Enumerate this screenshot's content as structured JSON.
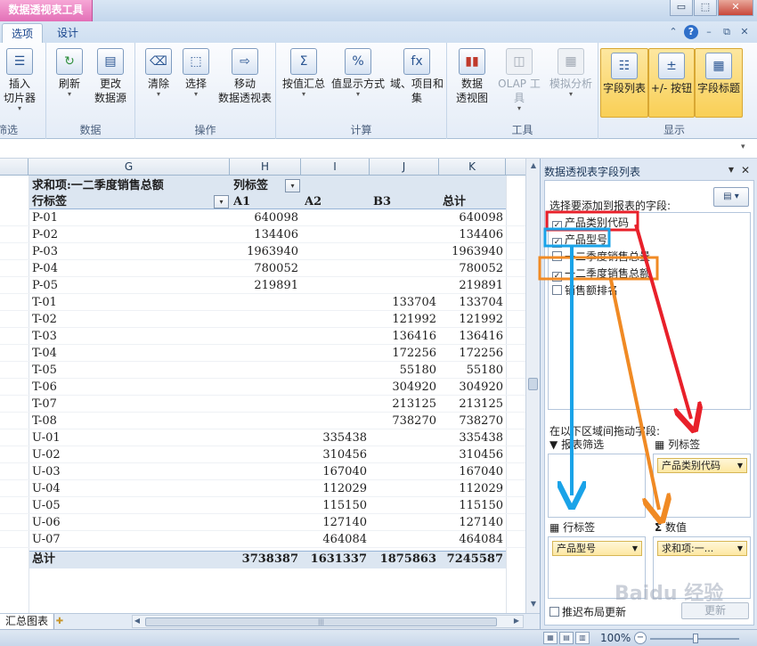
{
  "titlebar": {
    "context_tab": "数据透视表工具",
    "controls": [
      "▭",
      "⬚",
      "✕"
    ]
  },
  "tabs": [
    {
      "label": "选项",
      "active": true
    },
    {
      "label": "设计",
      "active": false
    }
  ],
  "ribbon": {
    "groups": [
      {
        "label": "筛选",
        "buttons": [
          {
            "label": "插入\n切片器"
          }
        ]
      },
      {
        "label": "数据",
        "buttons": [
          {
            "label": "刷新"
          },
          {
            "label": "更改\n数据源"
          }
        ]
      },
      {
        "label": "操作",
        "buttons": [
          {
            "label": "清除"
          },
          {
            "label": "选择"
          },
          {
            "label": "移动\n数据透视表"
          }
        ]
      },
      {
        "label": "计算",
        "buttons": [
          {
            "label": "按值汇总"
          },
          {
            "label": "值显示方式"
          },
          {
            "label": "域、项目和\n集"
          }
        ]
      },
      {
        "label": "工具",
        "buttons": [
          {
            "label": "数据\n透视图"
          },
          {
            "label": "OLAP 工具"
          },
          {
            "label": "模拟分析"
          }
        ]
      },
      {
        "label": "显示",
        "buttons": [
          {
            "label": "字段列表"
          },
          {
            "label": "+/- 按钮"
          },
          {
            "label": "字段标题"
          }
        ]
      }
    ]
  },
  "sheet": {
    "columns": [
      "G",
      "H",
      "I",
      "J",
      "K"
    ],
    "pivot": {
      "value_title": "求和项:一二季度销售总额",
      "col_label_header": "列标签",
      "row_label_header": "行标签",
      "col_items": [
        "A1",
        "A2",
        "B3",
        "总计"
      ],
      "rows": [
        {
          "label": "P-01",
          "a1": "640098",
          "a2": "",
          "b3": "",
          "total": "640098"
        },
        {
          "label": "P-02",
          "a1": "134406",
          "a2": "",
          "b3": "",
          "total": "134406"
        },
        {
          "label": "P-03",
          "a1": "1963940",
          "a2": "",
          "b3": "",
          "total": "1963940"
        },
        {
          "label": "P-04",
          "a1": "780052",
          "a2": "",
          "b3": "",
          "total": "780052"
        },
        {
          "label": "P-05",
          "a1": "219891",
          "a2": "",
          "b3": "",
          "total": "219891"
        },
        {
          "label": "T-01",
          "a1": "",
          "a2": "",
          "b3": "133704",
          "total": "133704"
        },
        {
          "label": "T-02",
          "a1": "",
          "a2": "",
          "b3": "121992",
          "total": "121992"
        },
        {
          "label": "T-03",
          "a1": "",
          "a2": "",
          "b3": "136416",
          "total": "136416"
        },
        {
          "label": "T-04",
          "a1": "",
          "a2": "",
          "b3": "172256",
          "total": "172256"
        },
        {
          "label": "T-05",
          "a1": "",
          "a2": "",
          "b3": "55180",
          "total": "55180"
        },
        {
          "label": "T-06",
          "a1": "",
          "a2": "",
          "b3": "304920",
          "total": "304920"
        },
        {
          "label": "T-07",
          "a1": "",
          "a2": "",
          "b3": "213125",
          "total": "213125"
        },
        {
          "label": "T-08",
          "a1": "",
          "a2": "",
          "b3": "738270",
          "total": "738270"
        },
        {
          "label": "U-01",
          "a1": "",
          "a2": "335438",
          "b3": "",
          "total": "335438"
        },
        {
          "label": "U-02",
          "a1": "",
          "a2": "310456",
          "b3": "",
          "total": "310456"
        },
        {
          "label": "U-03",
          "a1": "",
          "a2": "167040",
          "b3": "",
          "total": "167040"
        },
        {
          "label": "U-04",
          "a1": "",
          "a2": "112029",
          "b3": "",
          "total": "112029"
        },
        {
          "label": "U-05",
          "a1": "",
          "a2": "115150",
          "b3": "",
          "total": "115150"
        },
        {
          "label": "U-06",
          "a1": "",
          "a2": "127140",
          "b3": "",
          "total": "127140"
        },
        {
          "label": "U-07",
          "a1": "",
          "a2": "464084",
          "b3": "",
          "total": "464084"
        }
      ],
      "grand_total": {
        "label": "总计",
        "a1": "3738387",
        "a2": "1631337",
        "b3": "1875863",
        "total": "7245587"
      }
    },
    "sheet_tab": "汇总图表"
  },
  "field_pane": {
    "title": "数据透视表字段列表",
    "choose_label": "选择要添加到报表的字段:",
    "fields": [
      {
        "label": "产品类别代码",
        "checked": true
      },
      {
        "label": "产品型号",
        "checked": true
      },
      {
        "label": "一二季度销售总量",
        "checked": false
      },
      {
        "label": "一二季度销售总额",
        "checked": true
      },
      {
        "label": "销售额排名",
        "checked": false
      }
    ],
    "drag_label": "在以下区域间拖动字段:",
    "areas": {
      "filter_label": "报表筛选",
      "col_label": "列标签",
      "row_label": "行标签",
      "values_label": "数值",
      "col_chip": "产品类别代码",
      "row_chip": "产品型号",
      "values_chip": "求和项:一..."
    },
    "defer_label": "推迟布局更新",
    "update_button": "更新"
  },
  "status": {
    "zoom": "100%"
  },
  "watermark": "Baidu 经验",
  "colors": {
    "red": "#e8202a",
    "blue": "#1aa3e8",
    "orange": "#f08a24",
    "pivot_band": "#dce6f1",
    "context_tab": "#e36fb7"
  }
}
